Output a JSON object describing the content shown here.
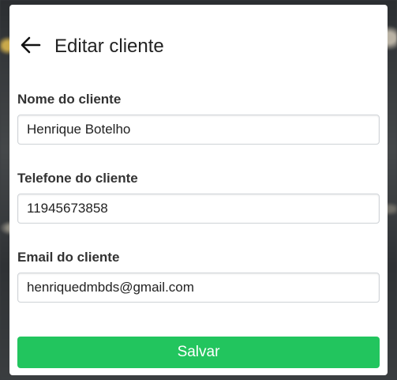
{
  "modal": {
    "title": "Editar cliente",
    "back_icon": "arrow-left-icon"
  },
  "form": {
    "name": {
      "label": "Nome do cliente",
      "value": "Henrique Botelho"
    },
    "phone": {
      "label": "Telefone do cliente",
      "value": "11945673858"
    },
    "email": {
      "label": "Email do cliente",
      "value": "henriquedmbds@gmail.com"
    },
    "save_label": "Salvar"
  },
  "colors": {
    "accent": "#22c55e",
    "text": "#222222",
    "label": "#333333",
    "border": "#cfd3d7"
  }
}
